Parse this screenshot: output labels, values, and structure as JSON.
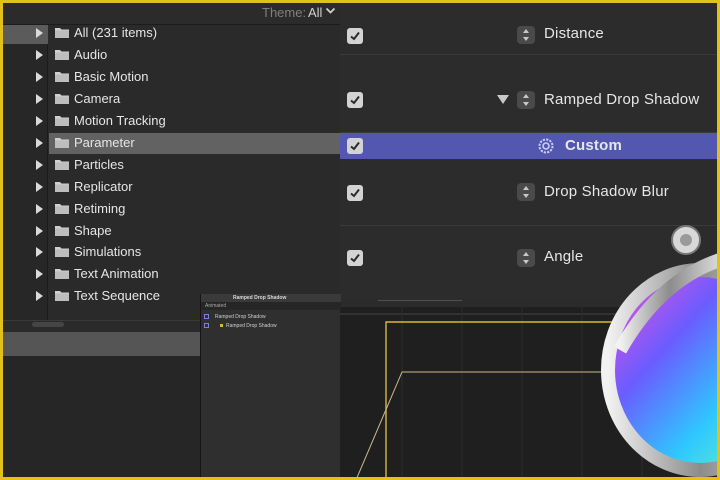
{
  "theme": {
    "label": "Theme:",
    "value": "All"
  },
  "library": {
    "items": [
      {
        "label": "All (231 items)"
      },
      {
        "label": "Audio"
      },
      {
        "label": "Basic Motion"
      },
      {
        "label": "Camera"
      },
      {
        "label": "Motion Tracking"
      },
      {
        "label": "Parameter",
        "selected": true
      },
      {
        "label": "Particles"
      },
      {
        "label": "Replicator"
      },
      {
        "label": "Retiming"
      },
      {
        "label": "Shape"
      },
      {
        "label": "Simulations"
      },
      {
        "label": "Text Animation"
      },
      {
        "label": "Text Sequence"
      }
    ]
  },
  "parameters": {
    "rows": [
      {
        "label": "Distance",
        "checked": true
      },
      {
        "label": "Ramped Drop Shadow",
        "checked": true
      },
      {
        "label": "Custom",
        "checked": true,
        "selected": true
      },
      {
        "label": "Drop Shadow Blur",
        "checked": true
      },
      {
        "label": "Angle",
        "checked": true
      }
    ]
  },
  "inset": {
    "title": "Ramped Drop Shadow",
    "subtitle": "Animated",
    "rows": [
      {
        "label": "Ramped Drop Shadow"
      },
      {
        "label": "Ramped Drop Shadow"
      }
    ]
  },
  "colors": {
    "accent_selection": "#5357b0",
    "list_selection": "#626262",
    "keyframe_curve": "#d8b93a",
    "frame_border": "#e2c21a"
  }
}
